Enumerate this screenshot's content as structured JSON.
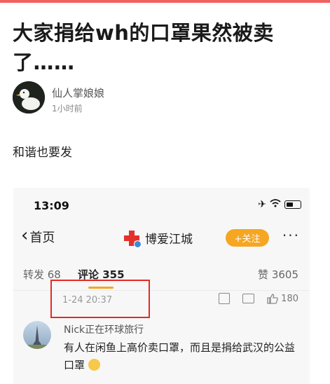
{
  "post": {
    "title": "大家捐给wh的口罩果然被卖了……",
    "author": "仙人掌娘娘",
    "time": "1小时前",
    "body": "和谐也要发"
  },
  "screenshot": {
    "status_time": "13:09",
    "back_label": "首页",
    "account_name": "博爱江城",
    "follow_label": "+关注",
    "more_label": "···",
    "tabs": {
      "repost": "转发 68",
      "comment": "评论 355",
      "like": "赞 3605"
    },
    "comment_date": "1-24 20:37",
    "like_count": "180",
    "comment": {
      "user": "Nick正在环球旅行",
      "text": "有人在闲鱼上高价卖口罩，而且是捐给武汉的公益口罩"
    }
  },
  "colors": {
    "accent": "#f1605f",
    "follow": "#f5a623",
    "highlight": "#e42a26"
  }
}
